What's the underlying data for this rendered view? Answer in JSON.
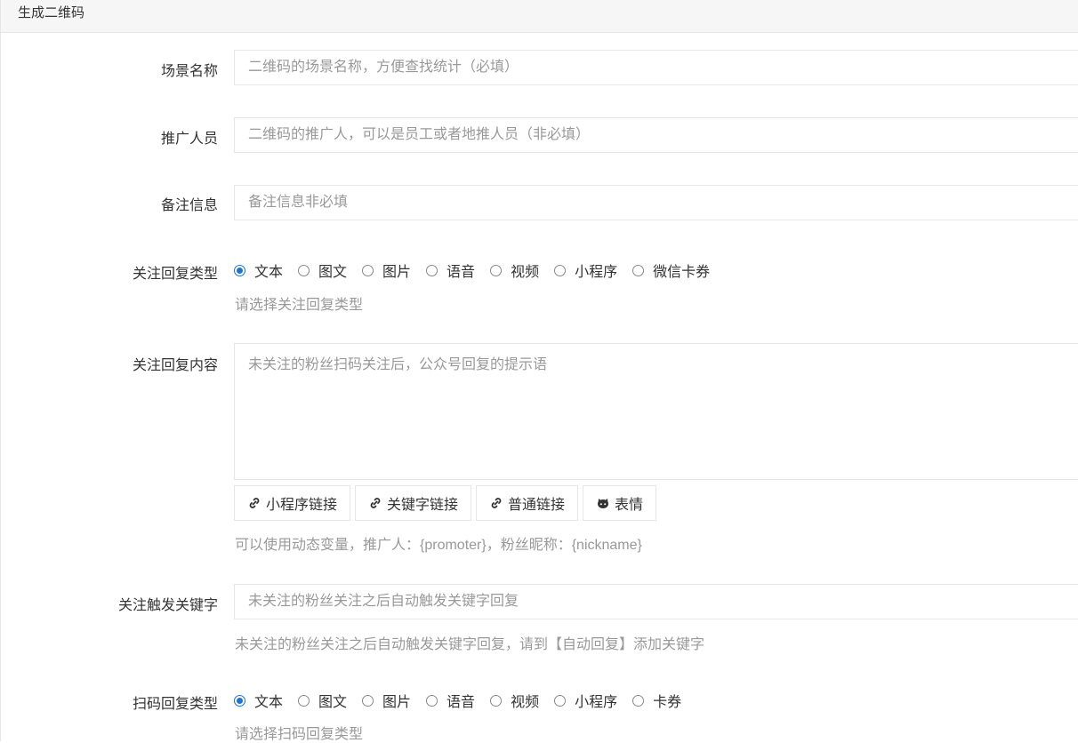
{
  "header": {
    "title": "生成二维码"
  },
  "form": {
    "scene_name": {
      "label": "场景名称",
      "value": "",
      "placeholder": "二维码的场景名称，方便查找统计（必填）"
    },
    "promoter": {
      "label": "推广人员",
      "value": "",
      "placeholder": "二维码的推广人，可以是员工或者地推人员（非必填）"
    },
    "remark": {
      "label": "备注信息",
      "value": "",
      "placeholder": "备注信息非必填"
    },
    "follow_reply_type": {
      "label": "关注回复类型",
      "options": [
        "文本",
        "图文",
        "图片",
        "语音",
        "视频",
        "小程序",
        "微信卡券"
      ],
      "selected": "文本",
      "help": "请选择关注回复类型"
    },
    "follow_reply_content": {
      "label": "关注回复内容",
      "value": "",
      "placeholder": "未关注的粉丝扫码关注后，公众号回复的提示语",
      "buttons": [
        "小程序链接",
        "关键字链接",
        "普通链接",
        "表情"
      ],
      "help": "可以使用动态变量，推广人：{promoter}，粉丝昵称：{nickname}"
    },
    "follow_keyword": {
      "label": "关注触发关键字",
      "value": "",
      "placeholder": "未关注的粉丝关注之后自动触发关键字回复",
      "help": "未关注的粉丝关注之后自动触发关键字回复，请到【自动回复】添加关键字"
    },
    "scan_reply_type": {
      "label": "扫码回复类型",
      "options": [
        "文本",
        "图文",
        "图片",
        "语音",
        "视频",
        "小程序",
        "卡券"
      ],
      "selected": "文本",
      "help": "请选择扫码回复类型"
    }
  },
  "icons": {
    "link": "link-icon",
    "emoji": "github-cat-icon"
  },
  "colors": {
    "accent": "#1e73d8",
    "placeholder": "#999999",
    "border": "#e6e6e6",
    "header_bg": "#f6f6f6"
  }
}
